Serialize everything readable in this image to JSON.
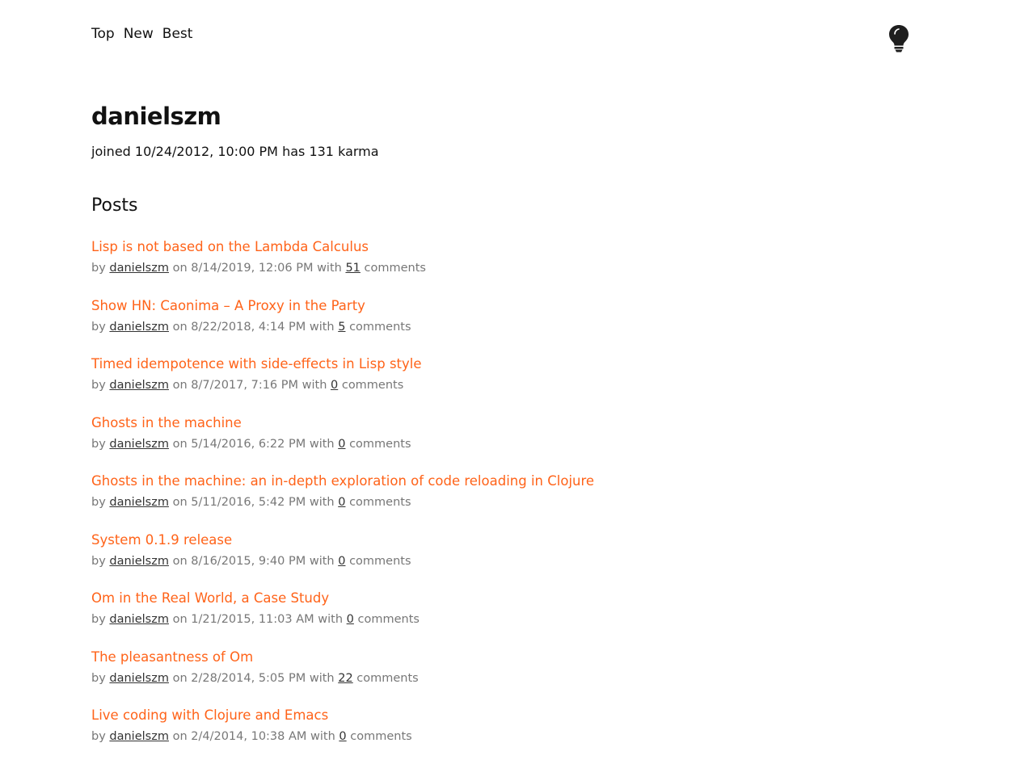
{
  "nav": {
    "items": [
      "Top",
      "New",
      "Best"
    ],
    "theme_icon": "lightbulb-icon"
  },
  "user": {
    "name": "danielszm",
    "joined_label": "joined",
    "joined": "10/24/2012, 10:00 PM",
    "has_label": "has",
    "karma": "131",
    "karma_label": "karma"
  },
  "posts_heading": "Posts",
  "meta_labels": {
    "by": "by",
    "on": "on",
    "with": "with",
    "comments": "comments"
  },
  "colors": {
    "link": "#ff6319",
    "meta": "#777777"
  },
  "posts": [
    {
      "title": "Lisp is not based on the Lambda Calculus",
      "author": "danielszm",
      "date": "8/14/2019, 12:06 PM",
      "comments": "51"
    },
    {
      "title": "Show HN: Caonima – A Proxy in the Party",
      "author": "danielszm",
      "date": "8/22/2018, 4:14 PM",
      "comments": "5"
    },
    {
      "title": "Timed idempotence with side-effects in Lisp style",
      "author": "danielszm",
      "date": "8/7/2017, 7:16 PM",
      "comments": "0"
    },
    {
      "title": "Ghosts in the machine",
      "author": "danielszm",
      "date": "5/14/2016, 6:22 PM",
      "comments": "0"
    },
    {
      "title": "Ghosts in the machine: an in-depth exploration of code reloading in Clojure",
      "author": "danielszm",
      "date": "5/11/2016, 5:42 PM",
      "comments": "0"
    },
    {
      "title": "System 0.1.9 release",
      "author": "danielszm",
      "date": "8/16/2015, 9:40 PM",
      "comments": "0"
    },
    {
      "title": "Om in the Real World, a Case Study",
      "author": "danielszm",
      "date": "1/21/2015, 11:03 AM",
      "comments": "0"
    },
    {
      "title": "The pleasantness of Om",
      "author": "danielszm",
      "date": "2/28/2014, 5:05 PM",
      "comments": "22"
    },
    {
      "title": "Live coding with Clojure and Emacs",
      "author": "danielszm",
      "date": "2/4/2014, 10:38 AM",
      "comments": "0"
    }
  ]
}
